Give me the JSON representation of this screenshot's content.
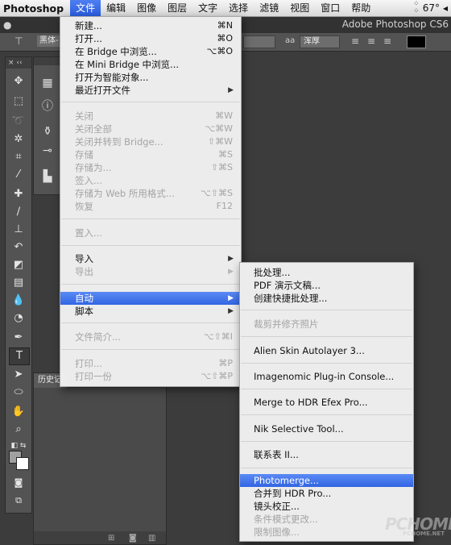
{
  "menubar": {
    "app_name": "Photoshop",
    "items": [
      "文件",
      "编辑",
      "图像",
      "图层",
      "文字",
      "选择",
      "滤镜",
      "视图",
      "窗口",
      "帮助"
    ],
    "temperature": "67°"
  },
  "options_bar": {
    "app_title": "Adobe Photoshop CS6",
    "font_family": "黑体-",
    "antialias": "浑厚",
    "size_icon": "aa"
  },
  "toolbox": {
    "selected_tool": "type-tool"
  },
  "history_panel": {
    "tab_label": "历史记"
  },
  "file_menu": {
    "items": [
      {
        "label": "新建...",
        "shortcut": "⌘N",
        "disabled": false
      },
      {
        "label": "打开...",
        "shortcut": "⌘O",
        "disabled": false
      },
      {
        "label": "在 Bridge 中浏览...",
        "shortcut": "⌥⌘O",
        "disabled": false
      },
      {
        "label": "在 Mini Bridge 中浏览...",
        "shortcut": "",
        "disabled": false
      },
      {
        "label": "打开为智能对象...",
        "shortcut": "",
        "disabled": false
      },
      {
        "label": "最近打开文件",
        "shortcut": "",
        "disabled": false,
        "submenu": true
      },
      {
        "label": "关闭",
        "shortcut": "⌘W",
        "disabled": true
      },
      {
        "label": "关闭全部",
        "shortcut": "⌥⌘W",
        "disabled": true
      },
      {
        "label": "关闭并转到 Bridge...",
        "shortcut": "⇧⌘W",
        "disabled": true
      },
      {
        "label": "存储",
        "shortcut": "⌘S",
        "disabled": true
      },
      {
        "label": "存储为...",
        "shortcut": "⇧⌘S",
        "disabled": true
      },
      {
        "label": "签入...",
        "shortcut": "",
        "disabled": true
      },
      {
        "label": "存储为 Web 所用格式...",
        "shortcut": "⌥⇧⌘S",
        "disabled": true
      },
      {
        "label": "恢复",
        "shortcut": "F12",
        "disabled": true
      },
      {
        "label": "置入...",
        "shortcut": "",
        "disabled": true
      },
      {
        "label": "导入",
        "shortcut": "",
        "disabled": false,
        "submenu": true
      },
      {
        "label": "导出",
        "shortcut": "",
        "disabled": true,
        "submenu": true
      },
      {
        "label": "自动",
        "shortcut": "",
        "disabled": false,
        "submenu": true,
        "highlighted": true
      },
      {
        "label": "脚本",
        "shortcut": "",
        "disabled": false,
        "submenu": true
      },
      {
        "label": "文件简介...",
        "shortcut": "⌥⇧⌘I",
        "disabled": true
      },
      {
        "label": "打印...",
        "shortcut": "⌘P",
        "disabled": true
      },
      {
        "label": "打印一份",
        "shortcut": "⌥⇧⌘P",
        "disabled": true
      }
    ]
  },
  "automate_submenu": {
    "items": [
      {
        "label": "批处理...",
        "disabled": false
      },
      {
        "label": "PDF 演示文稿...",
        "disabled": false
      },
      {
        "label": "创建快捷批处理...",
        "disabled": false
      },
      {
        "label": "裁剪并修齐照片",
        "disabled": true
      },
      {
        "label": "Alien Skin Autolayer 3...",
        "disabled": false
      },
      {
        "label": "Imagenomic Plug-in Console...",
        "disabled": false
      },
      {
        "label": "Merge to HDR Efex Pro...",
        "disabled": false
      },
      {
        "label": "Nik Selective Tool...",
        "disabled": false
      },
      {
        "label": "联系表 II...",
        "disabled": false
      },
      {
        "label": "Photomerge...",
        "disabled": false,
        "highlighted": true
      },
      {
        "label": "合并到 HDR Pro...",
        "disabled": false
      },
      {
        "label": "镜头校正...",
        "disabled": false
      },
      {
        "label": "条件模式更改...",
        "disabled": true
      },
      {
        "label": "限制图像...",
        "disabled": true
      }
    ]
  },
  "watermark": {
    "brand": "PCHOME",
    "url": "PCHOME.NET"
  }
}
